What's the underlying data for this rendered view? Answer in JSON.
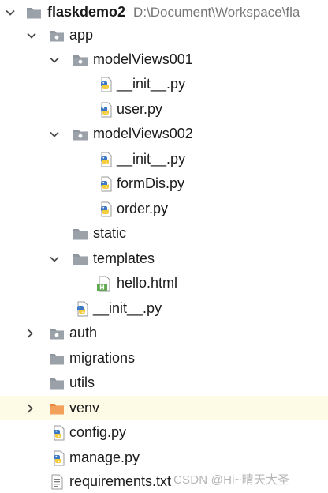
{
  "project": {
    "name": "flaskdemo2",
    "path": "D:\\Document\\Workspace\\fla"
  },
  "tree": {
    "app": "app",
    "modelViews001": "modelViews001",
    "mv1_init": "__init__.py",
    "mv1_user": "user.py",
    "modelViews002": "modelViews002",
    "mv2_init": "__init__.py",
    "mv2_formDis": "formDis.py",
    "mv2_order": "order.py",
    "static": "static",
    "templates": "templates",
    "hello_html": "hello.html",
    "app_init": "__init__.py",
    "auth": "auth",
    "migrations": "migrations",
    "utils": "utils",
    "venv": "venv",
    "config": "config.py",
    "manage": "manage.py",
    "requirements": "requirements.txt"
  },
  "watermark": "CSDN @Hi~晴天大圣",
  "colors": {
    "folder": "#8f969e",
    "venv_folder": "#f3a05a",
    "highlight_row": "#fdfbe6",
    "python_blue": "#3d78c4",
    "python_yellow": "#f4cc3c",
    "html_green": "#5fa84f"
  }
}
